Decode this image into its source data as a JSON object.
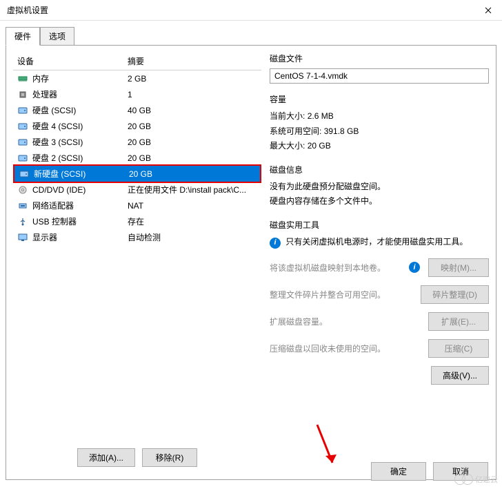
{
  "window": {
    "title": "虚拟机设置"
  },
  "tabs": {
    "hardware": "硬件",
    "options": "选项"
  },
  "hw_table": {
    "col_device": "设备",
    "col_summary": "摘要",
    "rows": [
      {
        "icon": "memory-icon",
        "device": "内存",
        "summary": "2 GB"
      },
      {
        "icon": "cpu-icon",
        "device": "处理器",
        "summary": "1"
      },
      {
        "icon": "disk-icon",
        "device": "硬盘 (SCSI)",
        "summary": "40 GB"
      },
      {
        "icon": "disk-icon",
        "device": "硬盘 4 (SCSI)",
        "summary": "20 GB"
      },
      {
        "icon": "disk-icon",
        "device": "硬盘 3 (SCSI)",
        "summary": "20 GB"
      },
      {
        "icon": "disk-icon",
        "device": "硬盘 2 (SCSI)",
        "summary": "20 GB"
      },
      {
        "icon": "disk-icon",
        "device": "新硬盘 (SCSI)",
        "summary": "20 GB",
        "selected": true,
        "highlighted": true
      },
      {
        "icon": "cd-icon",
        "device": "CD/DVD (IDE)",
        "summary": "正在使用文件 D:\\install pack\\C..."
      },
      {
        "icon": "net-icon",
        "device": "网络适配器",
        "summary": "NAT"
      },
      {
        "icon": "usb-icon",
        "device": "USB 控制器",
        "summary": "存在"
      },
      {
        "icon": "display-icon",
        "device": "显示器",
        "summary": "自动检测"
      }
    ]
  },
  "left_buttons": {
    "add": "添加(A)...",
    "remove": "移除(R)"
  },
  "disk_file": {
    "title": "磁盘文件",
    "value": "CentOS 7-1-4.vmdk"
  },
  "capacity": {
    "title": "容量",
    "current_label": "当前大小:",
    "current_value": "2.6 MB",
    "free_label": "系统可用空间:",
    "free_value": "391.8 GB",
    "max_label": "最大大小:",
    "max_value": "20 GB"
  },
  "disk_info": {
    "title": "磁盘信息",
    "line1": "没有为此硬盘预分配磁盘空间。",
    "line2": "硬盘内容存储在多个文件中。"
  },
  "utilities": {
    "title": "磁盘实用工具",
    "notice": "只有关闭虚拟机电源时，才能使用磁盘实用工具。",
    "map_desc": "将该虚拟机磁盘映射到本地卷。",
    "map_btn": "映射(M)...",
    "defrag_desc": "整理文件碎片并整合可用空间。",
    "defrag_btn": "碎片整理(D)",
    "expand_desc": "扩展磁盘容量。",
    "expand_btn": "扩展(E)...",
    "compact_desc": "压缩磁盘以回收未使用的空间。",
    "compact_btn": "压缩(C)",
    "advanced_btn": "高级(V)..."
  },
  "bottom": {
    "ok": "确定",
    "cancel": "取消"
  },
  "watermark": "亿速云"
}
